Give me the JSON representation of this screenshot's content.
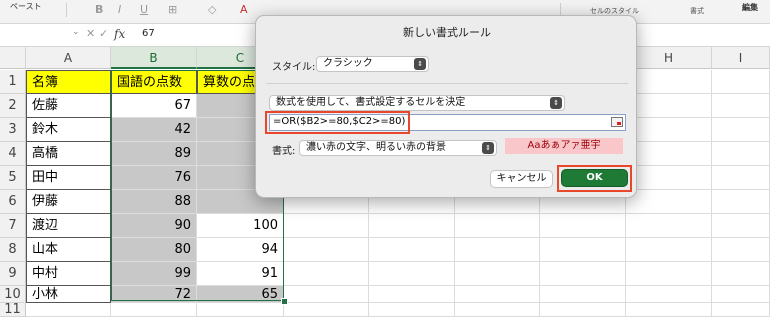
{
  "ribbon": {
    "paste_label": "ペースト",
    "bold": "B",
    "italic": "I",
    "underline": "U",
    "borders_icon": "borders-icon",
    "fill_color_icon": "fill-color-icon",
    "font_color_icon": "font-color-icon",
    "cell_styles_label": "セルのスタイル",
    "format_label": "書式",
    "edit_label": "編集"
  },
  "formula_bar": {
    "name_box": "",
    "cancel_glyph": "✕",
    "enter_glyph": "✓",
    "fx_label": "fx",
    "value": "67"
  },
  "sheet": {
    "columns": [
      "A",
      "B",
      "C",
      "D",
      "E",
      "F",
      "G",
      "H",
      "I"
    ],
    "rows": [
      "1",
      "2",
      "3",
      "4",
      "5",
      "6",
      "7",
      "8",
      "9",
      "10",
      "11"
    ],
    "headers": [
      "名簿",
      "国語の点数",
      "算数の点数"
    ],
    "names": [
      "佐藤",
      "鈴木",
      "高橋",
      "田中",
      "伊藤",
      "渡辺",
      "山本",
      "中村",
      "小林"
    ],
    "col_b": [
      "67",
      "42",
      "89",
      "76",
      "88",
      "90",
      "80",
      "99",
      "72"
    ],
    "col_c": [
      "",
      "",
      "",
      "",
      "",
      "100",
      "94",
      "91",
      "65"
    ],
    "gray_rows_b": [
      false,
      true,
      true,
      true,
      true,
      true,
      true,
      true,
      true
    ],
    "gray_rows_c": [
      true,
      true,
      true,
      true,
      true,
      false,
      false,
      false,
      true
    ],
    "header_fill": "#ffff00",
    "gray_fill": "#c8c8c8",
    "selection_color": "#217346"
  },
  "dialog": {
    "title": "新しい書式ルール",
    "style_label": "スタイル:",
    "style_value": "クラシック",
    "rule_type": "数式を使用して、書式設定するセルを決定",
    "formula": "=OR($B2>=80,$C2>=80)",
    "format_label": "書式:",
    "format_value": "濃い赤の文字、明るい赤の背景",
    "preview_text": "Aaあぁアァ亜宇",
    "cancel_button": "キャンセル",
    "ok_button": "OK",
    "highlight_color": "#e8472b",
    "ok_color": "#1f7a36"
  }
}
